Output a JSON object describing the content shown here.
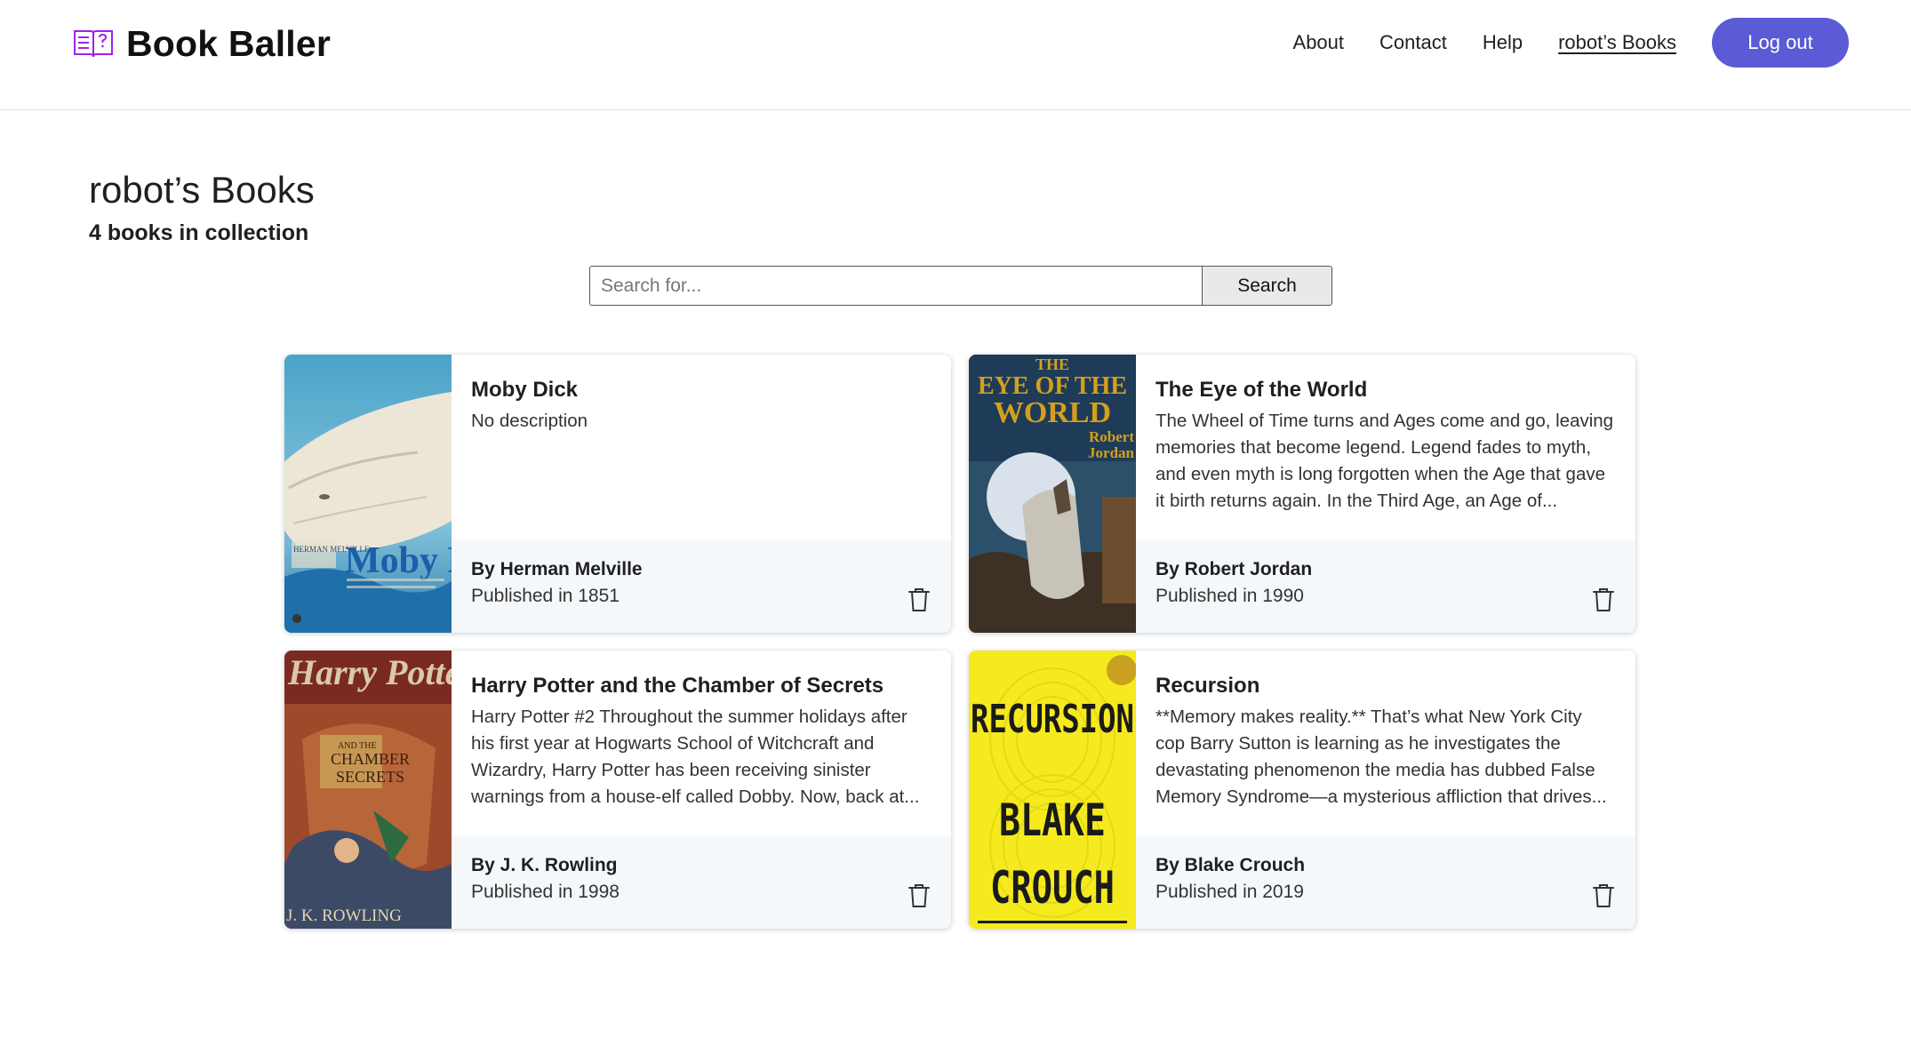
{
  "header": {
    "brand": "Book Baller",
    "nav": {
      "about": "About",
      "contact": "Contact",
      "help": "Help",
      "my_books": "robot’s Books"
    },
    "logout_label": "Log out"
  },
  "page": {
    "title": "robot’s Books",
    "subtitle": "4 books in collection"
  },
  "search": {
    "placeholder": "Search for...",
    "button_label": "Search"
  },
  "books": [
    {
      "title": "Moby Dick",
      "description": "No description",
      "author": "By Herman Melville",
      "published": "Published in 1851",
      "cover_text": [
        "HERMAN MELVILLE",
        "Moby Di"
      ]
    },
    {
      "title": "The Eye of the World",
      "description": "The Wheel of Time turns and Ages come and go, leaving memories that become legend. Legend fades to myth, and even myth is long forgotten when the Age that gave it birth returns again. In the Third Age, an Age of...",
      "author": "By Robert Jordan",
      "published": "Published in 1990",
      "cover_text": [
        "THE",
        "EYE OF THE",
        "WORLD",
        "Robert",
        "Jordan"
      ]
    },
    {
      "title": "Harry Potter and the Chamber of Secrets",
      "description": "Harry Potter #2  Throughout the summer holidays after his first year at Hogwarts School of Witchcraft and Wizardry, Harry Potter has been receiving sinister warnings from a house-elf called Dobby.  Now, back at...",
      "author": "By J. K. Rowling",
      "published": "Published in 1998",
      "cover_text": [
        "Harry Potter",
        "AND THE",
        "CHAMBER",
        "SECRETS",
        "J. K. ROWLING"
      ]
    },
    {
      "title": "Recursion",
      "description": "**Memory makes reality.**  That’s what New York City cop Barry Sutton is learning as he investigates the devastating phenomenon the media has dubbed False Memory Syndrome—a mysterious affliction that drives...",
      "author": "By Blake Crouch",
      "published": "Published in 2019",
      "cover_text": [
        "RECURSION",
        "BLAKE",
        "CROUCH"
      ]
    }
  ],
  "colors": {
    "accent": "#5b5bd6",
    "brand_icon": "#a020f0",
    "card_footer": "#f5f8fb"
  },
  "icons": {
    "brand": "book-question-icon",
    "delete": "trash-icon"
  }
}
